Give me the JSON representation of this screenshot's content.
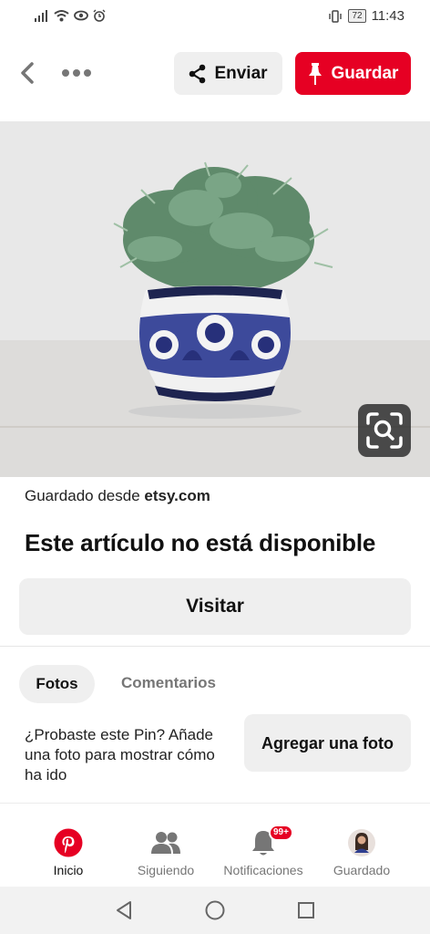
{
  "status_bar": {
    "time": "11:43",
    "battery": "72",
    "icons": [
      "signal-icon",
      "wifi-icon",
      "eye-icon",
      "alarm-icon",
      "vibrate-icon",
      "battery-icon"
    ]
  },
  "header": {
    "back_icon": "back-arrow-icon",
    "more_icon": "more-options-icon",
    "send_label": "Enviar",
    "save_label": "Guardar",
    "accent": "#e60023"
  },
  "image": {
    "subject": "plant-in-ceramic-pot",
    "lens_icon": "visual-search-icon"
  },
  "pin": {
    "saved_from_prefix": "Guardado desde",
    "saved_from_site": "etsy.com",
    "title": "Este artículo no está disponible",
    "visit_label": "Visitar"
  },
  "tabs": [
    {
      "label": "Fotos",
      "active": true
    },
    {
      "label": "Comentarios",
      "active": false
    }
  ],
  "photos": {
    "prompt": "¿Probaste este Pin? Añade una foto para mostrar cómo ha ido",
    "add_photo_label": "Agregar una foto"
  },
  "bottom_nav": [
    {
      "label": "Inicio",
      "icon": "pinterest-logo-icon",
      "active": true
    },
    {
      "label": "Siguiendo",
      "icon": "people-icon",
      "active": false
    },
    {
      "label": "Notificaciones",
      "icon": "bell-icon",
      "badge": "99+",
      "active": false
    },
    {
      "label": "Guardado",
      "icon": "avatar",
      "active": false
    }
  ],
  "system_nav": [
    "back-triangle-icon",
    "home-circle-icon",
    "recents-square-icon"
  ]
}
